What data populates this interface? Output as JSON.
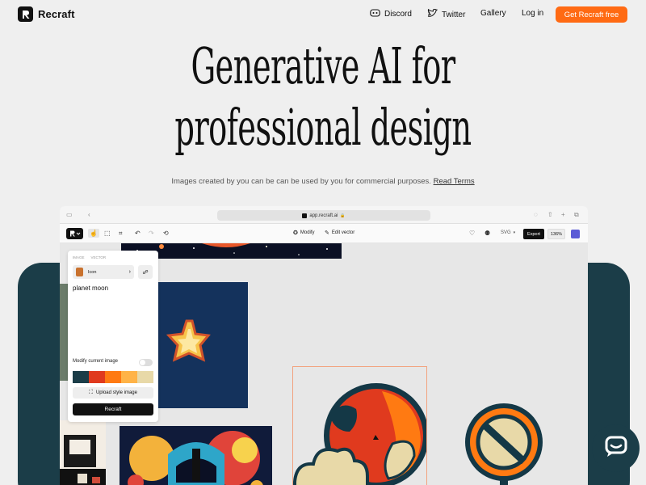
{
  "nav": {
    "brand": "Recraft",
    "links": [
      {
        "label": "Discord",
        "icon": "discord-icon"
      },
      {
        "label": "Twitter",
        "icon": "twitter-icon"
      },
      {
        "label": "Gallery"
      },
      {
        "label": "Log in"
      }
    ],
    "cta": "Get Recraft free"
  },
  "hero": {
    "title_line1": "Generative AI for",
    "title_line2": "professional design",
    "subtitle": "Images created by you can be can be used by you for commercial purposes.",
    "terms_link": "Read Terms"
  },
  "app": {
    "url": "app.recraft.ai",
    "toolbar": {
      "modify_label": "Modify",
      "edit_vector_label": "Edit vector",
      "format": "SVG",
      "export_label": "Export",
      "zoom": "136%"
    },
    "panel": {
      "tabs": [
        "IMAGE",
        "VECTOR"
      ],
      "style_name": "Icon",
      "prompt": "planet moon",
      "modify_label": "Modify current image",
      "palette": [
        "#1b3d48",
        "#e03a1e",
        "#ff7a12",
        "#ffb347",
        "#e8d9a8"
      ],
      "upload_label": "Upload style image",
      "generate_label": "Recraft"
    }
  },
  "colors": {
    "accent": "#ff6a13",
    "teal": "#1b3d48"
  }
}
